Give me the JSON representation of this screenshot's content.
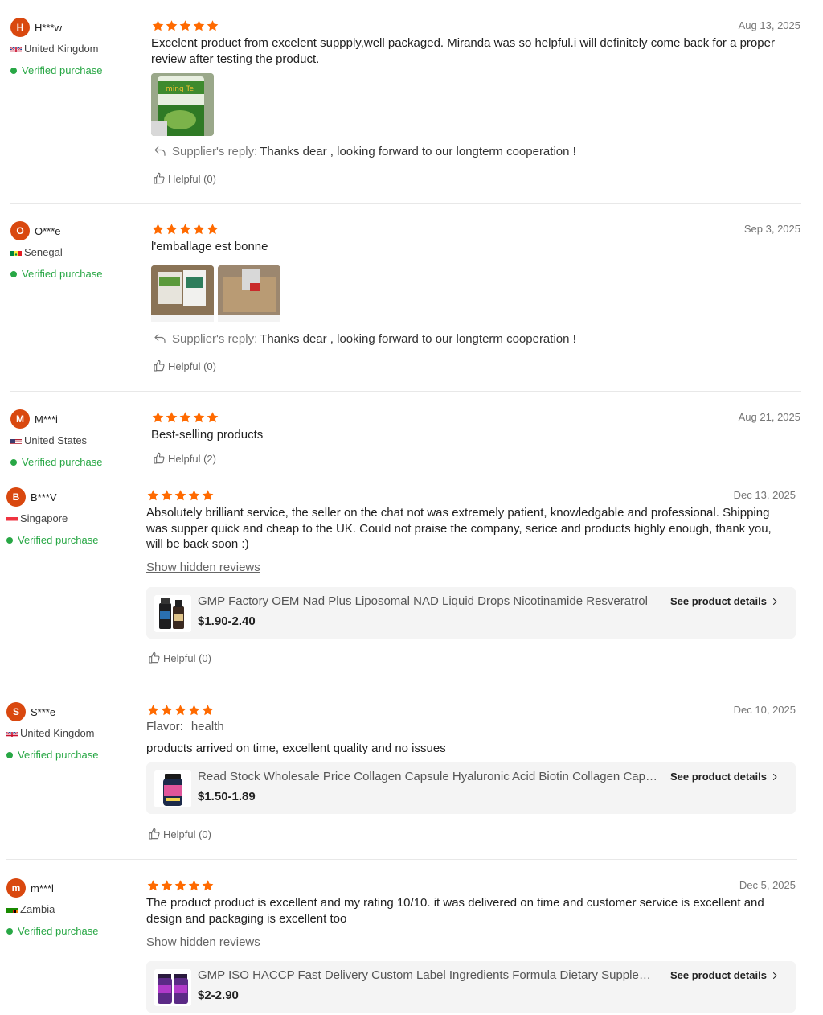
{
  "colors": {
    "star": "#ff6a00",
    "verified": "#28a745",
    "avatar_bg": "#d9480f",
    "product_bg": "#f4f4f4"
  },
  "reviews": [
    {
      "initial": "H",
      "user": "H***w",
      "country": "United Kingdom",
      "flag": "uk-flag",
      "verified": "Verified purchase",
      "rating": 5,
      "date": "Aug 13, 2025",
      "text": "Excelent product from excelent suppply,well packaged. Miranda was so helpful.i will definitely come back for a proper review after testing the product.",
      "reply_label": "Supplier's reply:",
      "reply_text": "Thanks dear , looking forward to our longterm cooperation !",
      "helpful": "Helpful (0)"
    },
    {
      "initial": "O",
      "user": "O***e",
      "country": "Senegal",
      "flag": "senegal-flag",
      "verified": "Verified purchase",
      "rating": 5,
      "date": "Sep 3, 2025",
      "text": "l'emballage est bonne",
      "reply_label": "Supplier's reply:",
      "reply_text": "Thanks dear , looking forward to our longterm cooperation !",
      "helpful": "Helpful (0)"
    },
    {
      "initial": "M",
      "user": "M***i",
      "country": "United States",
      "flag": "us-flag",
      "verified": "Verified purchase",
      "rating": 5,
      "date": "Aug 21, 2025",
      "text": "Best-selling products",
      "helpful": "Helpful (2)"
    },
    {
      "initial": "B",
      "user": "B***V",
      "country": "Singapore",
      "flag": "singapore-flag",
      "verified": "Verified purchase",
      "rating": 5,
      "date": "Dec 13, 2025",
      "text": "Absolutely brilliant service, the seller on the chat not was extremely patient, knowledgable and professional. Shipping was supper quick and cheap to the UK. Could not praise the company, serice and products highly enough, thank you, will be back soon :)",
      "show_hidden": "Show hidden reviews",
      "product_title": "GMP Factory OEM Nad Plus Liposomal NAD Liquid Drops Nicotinamide Resveratrol",
      "product_price": "$1.90-2.40",
      "product_link": "See product details",
      "helpful": "Helpful (0)"
    },
    {
      "initial": "S",
      "user": "S***e",
      "country": "United Kingdom",
      "flag": "uk-flag",
      "verified": "Verified purchase",
      "rating": 5,
      "date": "Dec 10, 2025",
      "flavor_key": "Flavor:",
      "flavor_value": "health",
      "text": "products arrived on time, excellent quality and no issues",
      "product_title": "Read Stock Wholesale Price Collagen Capsule Hyaluronic Acid Biotin Collagen Capsules",
      "product_price": "$1.50-1.89",
      "product_link": "See product details",
      "helpful": "Helpful (0)"
    },
    {
      "initial": "m",
      "user": "m***l",
      "country": "Zambia",
      "flag": "zambia-flag",
      "verified": "Verified purchase",
      "rating": 5,
      "date": "Dec 5, 2025",
      "text": "The product product is excellent and my rating 10/10. it was delivered on time and customer service is excellent and design and packaging is excellent too",
      "show_hidden": "Show hidden reviews",
      "product_title": "GMP ISO HACCP Fast Delivery Custom Label Ingredients Formula Dietary Supplements",
      "product_price": "$2-2.90",
      "product_link": "See product details"
    }
  ]
}
